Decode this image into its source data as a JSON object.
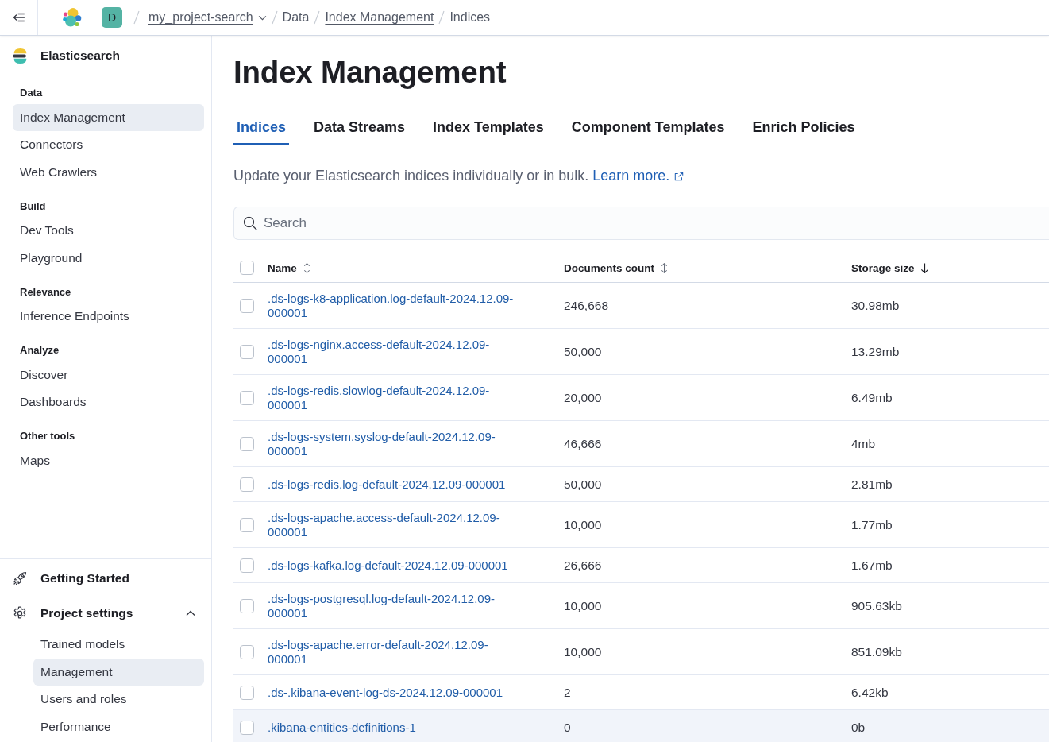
{
  "top_bar": {
    "avatar": "D",
    "breadcrumbs": [
      {
        "label": "my_project-search",
        "kind": "dropdown"
      },
      {
        "label": "Data",
        "kind": "text"
      },
      {
        "label": "Index Management",
        "kind": "link"
      },
      {
        "label": "Indices",
        "kind": "text"
      }
    ]
  },
  "sidebar": {
    "title": "Elasticsearch",
    "groups": [
      {
        "heading": "Data",
        "items": [
          {
            "label": "Index Management",
            "selected": true
          },
          {
            "label": "Connectors",
            "selected": false
          },
          {
            "label": "Web Crawlers",
            "selected": false
          }
        ]
      },
      {
        "heading": "Build",
        "items": [
          {
            "label": "Dev Tools",
            "selected": false
          },
          {
            "label": "Playground",
            "selected": false
          }
        ]
      },
      {
        "heading": "Relevance",
        "items": [
          {
            "label": "Inference Endpoints",
            "selected": false
          }
        ]
      },
      {
        "heading": "Analyze",
        "items": [
          {
            "label": "Discover",
            "selected": false
          },
          {
            "label": "Dashboards",
            "selected": false
          }
        ]
      },
      {
        "heading": "Other tools",
        "items": [
          {
            "label": "Maps",
            "selected": false
          }
        ]
      }
    ],
    "footer": [
      {
        "label": "Getting Started",
        "kind": "link"
      },
      {
        "label": "Project settings",
        "kind": "group",
        "expanded": true,
        "children": [
          {
            "label": "Trained models",
            "selected": false
          },
          {
            "label": "Management",
            "selected": true
          },
          {
            "label": "Users and roles",
            "selected": false
          },
          {
            "label": "Performance",
            "selected": false
          }
        ]
      }
    ]
  },
  "page": {
    "title": "Index Management",
    "tabs": [
      {
        "label": "Indices",
        "selected": true
      },
      {
        "label": "Data Streams",
        "selected": false
      },
      {
        "label": "Index Templates",
        "selected": false
      },
      {
        "label": "Component Templates",
        "selected": false
      },
      {
        "label": "Enrich Policies",
        "selected": false
      }
    ],
    "description": "Update your Elasticsearch indices individually or in bulk.",
    "learn_more": "Learn more.",
    "search": {
      "placeholder": "Search"
    }
  },
  "table": {
    "select_all": {
      "checked": false
    },
    "columns": [
      {
        "label": "Name",
        "sorted": false
      },
      {
        "label": "Documents count",
        "sorted": false
      },
      {
        "label": "Storage size",
        "sorted": true
      }
    ],
    "rows": [
      {
        "name": ".ds-logs-k8-application.log-default-2024.12.09-000001",
        "documents": "246,668",
        "storage": "30.98mb",
        "checked": false,
        "hovered": false
      },
      {
        "name": ".ds-logs-nginx.access-default-2024.12.09-000001",
        "documents": "50,000",
        "storage": "13.29mb",
        "checked": false,
        "hovered": false
      },
      {
        "name": ".ds-logs-redis.slowlog-default-2024.12.09-000001",
        "documents": "20,000",
        "storage": "6.49mb",
        "checked": false,
        "hovered": false
      },
      {
        "name": ".ds-logs-system.syslog-default-2024.12.09-000001",
        "documents": "46,666",
        "storage": "4mb",
        "checked": false,
        "hovered": false
      },
      {
        "name": ".ds-logs-redis.log-default-2024.12.09-000001",
        "documents": "50,000",
        "storage": "2.81mb",
        "checked": false,
        "hovered": false
      },
      {
        "name": ".ds-logs-apache.access-default-2024.12.09-000001",
        "documents": "10,000",
        "storage": "1.77mb",
        "checked": false,
        "hovered": false
      },
      {
        "name": ".ds-logs-kafka.log-default-2024.12.09-000001",
        "documents": "26,666",
        "storage": "1.67mb",
        "checked": false,
        "hovered": false
      },
      {
        "name": ".ds-logs-postgresql.log-default-2024.12.09-000001",
        "documents": "10,000",
        "storage": "905.63kb",
        "checked": false,
        "hovered": false
      },
      {
        "name": ".ds-logs-apache.error-default-2024.12.09-000001",
        "documents": "10,000",
        "storage": "851.09kb",
        "checked": false,
        "hovered": false
      },
      {
        "name": ".ds-.kibana-event-log-ds-2024.12.09-000001",
        "documents": "2",
        "storage": "6.42kb",
        "checked": false,
        "hovered": false
      },
      {
        "name": ".kibana-entities-definitions-1",
        "documents": "0",
        "storage": "0b",
        "checked": false,
        "hovered": true
      }
    ]
  }
}
